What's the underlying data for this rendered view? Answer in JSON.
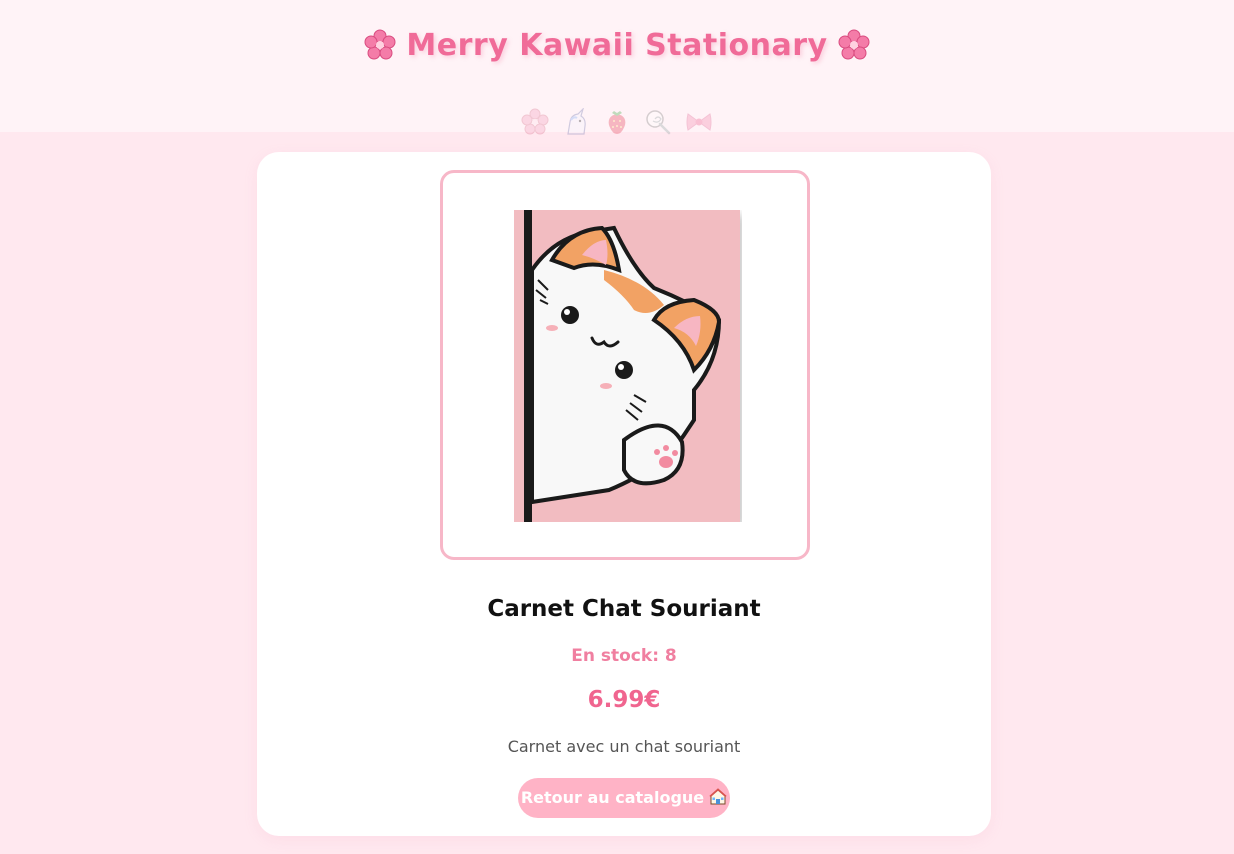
{
  "header": {
    "title": "Merry Kawaii Stationary",
    "left_icon": "cherry-blossom-icon",
    "right_icon": "cherry-blossom-icon",
    "decorations": [
      "cherry-blossom-icon",
      "unicorn-icon",
      "strawberry-icon",
      "lollipop-icon",
      "ribbon-icon"
    ]
  },
  "product": {
    "image_alt": "Carnet Chat Souriant",
    "name": "Carnet Chat Souriant",
    "stock_text": "En stock: 8",
    "price": "6.99€",
    "description": "Carnet avec un chat souriant"
  },
  "actions": {
    "back_label": "Retour au catalogue",
    "back_icon": "house-icon"
  },
  "colors": {
    "page_background": "#ffe8ef",
    "header_background": "#fff3f7",
    "accent": "#f06b98",
    "button": "#ffb3c6",
    "notebook_cover": "#f2bcc1"
  }
}
